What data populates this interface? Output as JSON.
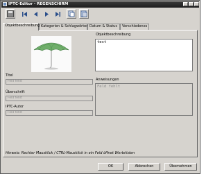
{
  "window": {
    "title": "IPTC-Editor - REGENSCHIRM"
  },
  "toolbar": {
    "buttons": [
      "save-icon",
      "first-icon",
      "previous-icon",
      "next-icon",
      "last-icon",
      "copy-icon",
      "paste-icon"
    ]
  },
  "tabs": [
    {
      "label": "Objektbeschreibung"
    },
    {
      "label": "Kategorien & Schlagwörter"
    },
    {
      "label": "Datum & Status"
    },
    {
      "label": "Verschiedenes"
    }
  ],
  "form": {
    "titel_label": "Titel",
    "titel_placeholder": "Feld fehlt",
    "ueberschrift_label": "Überschrift",
    "ueberschrift_placeholder": "Feld fehlt",
    "autor_label": "IPTC-Autor",
    "autor_placeholder": "Feld fehlt",
    "beschreibung_label": "Objektbeschreibung",
    "beschreibung_value": "test",
    "anweisungen_label": "Anweisungen",
    "anweisungen_placeholder": "Feld fehlt"
  },
  "hint": "Hinweis: Rechter Mausklick / CTRL-Mausklick in ein Feld öffnet Wertelisten",
  "buttons": {
    "ok": "OK",
    "cancel": "Abbrechen",
    "apply": "Übernehmen"
  },
  "colors": {
    "titlebar": "#262626",
    "window_bg": "#d6d3ce",
    "umbrella": "#6fae6a"
  }
}
